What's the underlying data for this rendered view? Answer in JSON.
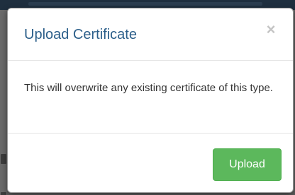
{
  "modal": {
    "title": "Upload Certificate",
    "close_glyph": "×",
    "close_icon": "close-icon",
    "body_text": "This will overwrite any existing certificate of this type.",
    "primary_button_label": "Upload"
  },
  "colors": {
    "title": "#2c5f8a",
    "primary_button": "#5cb85c",
    "body_text": "#333333",
    "close_icon": "#c4c4c4",
    "overlay": "#5e5e5e"
  }
}
